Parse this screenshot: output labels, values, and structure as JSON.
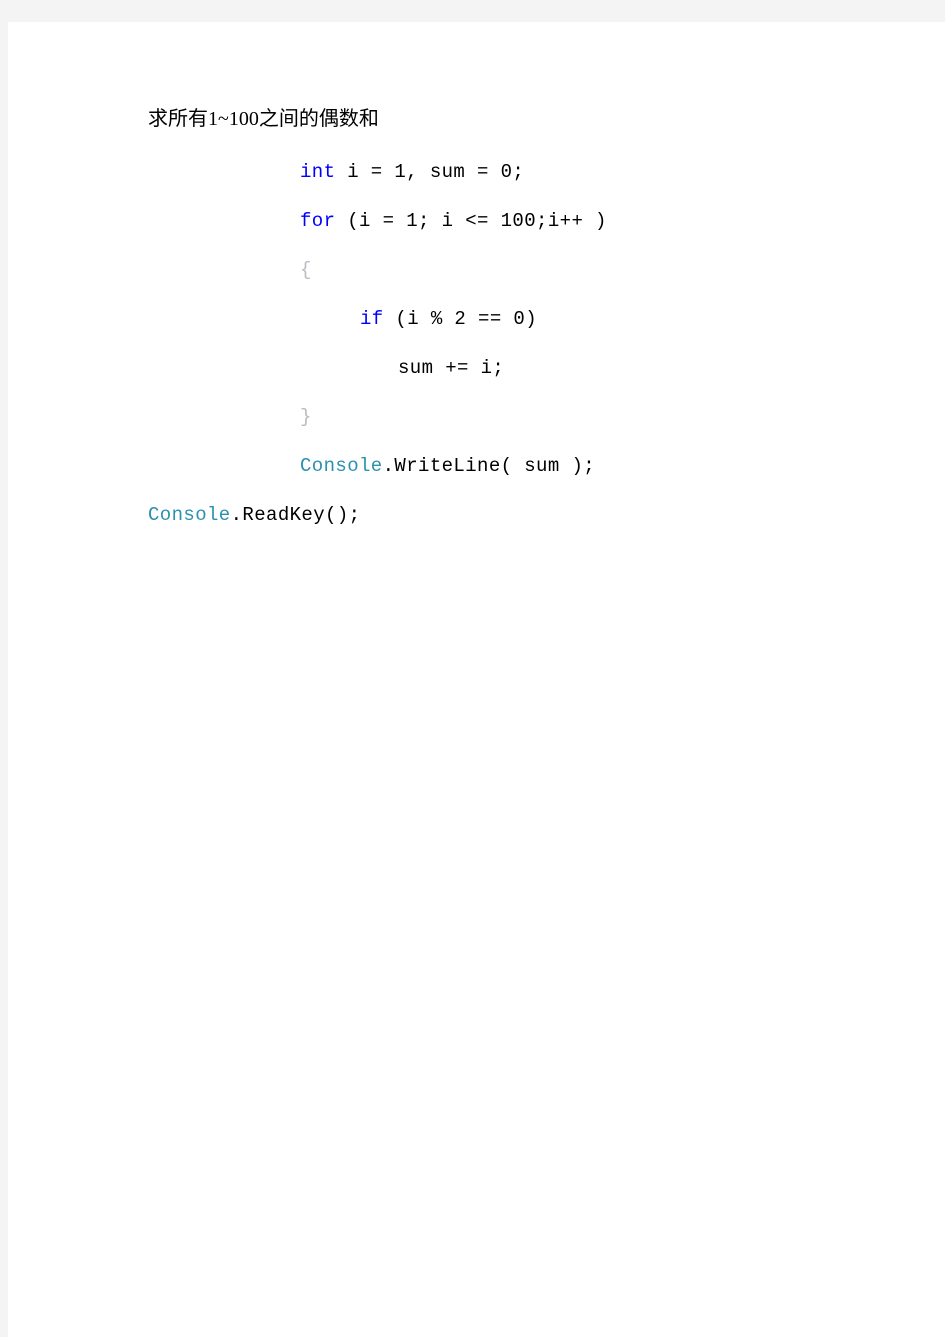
{
  "page": {
    "background_color": "#ffffff",
    "canvas_color": "#f4f4f4"
  },
  "document": {
    "title": "求所有1~100之间的偶数和",
    "colors": {
      "keyword": "#0000ff",
      "class_name": "#2b91af",
      "brace": "#b9bcc2",
      "text": "#000000"
    },
    "code": {
      "language": "csharp",
      "lines": [
        {
          "indent": 1,
          "segments": [
            {
              "text": "int",
              "kind": "keyword"
            },
            {
              "text": " i = 1, sum = 0;",
              "kind": "plain"
            }
          ],
          "plain_text": "int i = 1, sum = 0;"
        },
        {
          "indent": 1,
          "segments": [
            {
              "text": "for",
              "kind": "keyword"
            },
            {
              "text": " (i = 1; i <= 100;i++ )",
              "kind": "plain"
            }
          ],
          "plain_text": "for (i = 1; i <= 100;i++ )"
        },
        {
          "indent": 1,
          "segments": [
            {
              "text": "{",
              "kind": "brace"
            }
          ],
          "plain_text": "{"
        },
        {
          "indent": 2,
          "segments": [
            {
              "text": "if",
              "kind": "keyword"
            },
            {
              "text": " (i % 2 == 0)",
              "kind": "plain"
            }
          ],
          "plain_text": "if (i % 2 == 0)"
        },
        {
          "indent": 3,
          "segments": [
            {
              "text": "sum += i;",
              "kind": "plain"
            }
          ],
          "plain_text": "sum += i;"
        },
        {
          "indent": 1,
          "segments": [
            {
              "text": "}",
              "kind": "brace"
            }
          ],
          "plain_text": "}"
        },
        {
          "indent": 1,
          "segments": [
            {
              "text": "Console",
              "kind": "class_name"
            },
            {
              "text": ".WriteLine( sum );",
              "kind": "plain"
            }
          ],
          "plain_text": "Console.WriteLine( sum );"
        },
        {
          "indent": 0,
          "segments": [
            {
              "text": "Console",
              "kind": "class_name"
            },
            {
              "text": ".ReadKey();",
              "kind": "plain"
            }
          ],
          "plain_text": "Console.ReadKey();"
        }
      ]
    }
  }
}
